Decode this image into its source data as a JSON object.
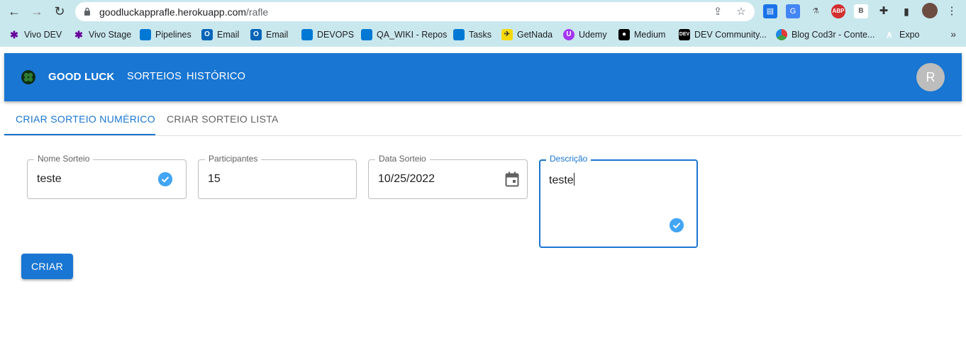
{
  "browser": {
    "url_host": "goodluckapprafle.herokuapp.com",
    "url_path": "/rafle",
    "bookmarks": [
      {
        "label": "Vivo DEV",
        "icon": "vivo-icon",
        "color": "#660099"
      },
      {
        "label": "Vivo Stage",
        "icon": "vivo-icon",
        "color": "#660099"
      },
      {
        "label": "Pipelines",
        "icon": "azure-devops-icon",
        "color": "#0078d4"
      },
      {
        "label": "Email",
        "icon": "outlook-icon",
        "color": "#0364b8"
      },
      {
        "label": "Email",
        "icon": "outlook-icon",
        "color": "#0364b8"
      },
      {
        "label": "DEVOPS",
        "icon": "azure-devops-icon",
        "color": "#0078d4"
      },
      {
        "label": "QA_WIKI - Repos",
        "icon": "azure-devops-icon",
        "color": "#0078d4"
      },
      {
        "label": "Tasks",
        "icon": "azure-devops-icon",
        "color": "#0078d4"
      },
      {
        "label": "GetNada",
        "icon": "getnada-icon",
        "color": "#f5d90a"
      },
      {
        "label": "Udemy",
        "icon": "udemy-icon",
        "color": "#a435f0"
      },
      {
        "label": "Medium",
        "icon": "medium-icon",
        "color": "#000000"
      },
      {
        "label": "DEV Community...",
        "icon": "dev-icon",
        "color": "#000000"
      },
      {
        "label": "Blog Cod3r - Conte...",
        "icon": "cod3r-icon",
        "color": "#e53935"
      },
      {
        "label": "Expo",
        "icon": "expo-icon",
        "color": "#ffffff"
      }
    ]
  },
  "app": {
    "brand": "GOOD LUCK",
    "nav": [
      "SORTEIOS",
      "HISTÓRICO"
    ],
    "avatar_initial": "R",
    "primary_color": "#1976d2"
  },
  "tabs": {
    "active": "CRIAR SORTEIO NUMÉRICO",
    "inactive": "CRIAR SORTEIO LISTA"
  },
  "form": {
    "nome": {
      "label": "Nome Sorteio",
      "value": "teste"
    },
    "participantes": {
      "label": "Participantes",
      "value": "15"
    },
    "data": {
      "label": "Data Sorteio",
      "value": "10/25/2022"
    },
    "descricao": {
      "label": "Descrição",
      "value": "teste"
    },
    "submit_label": "CRIAR"
  }
}
